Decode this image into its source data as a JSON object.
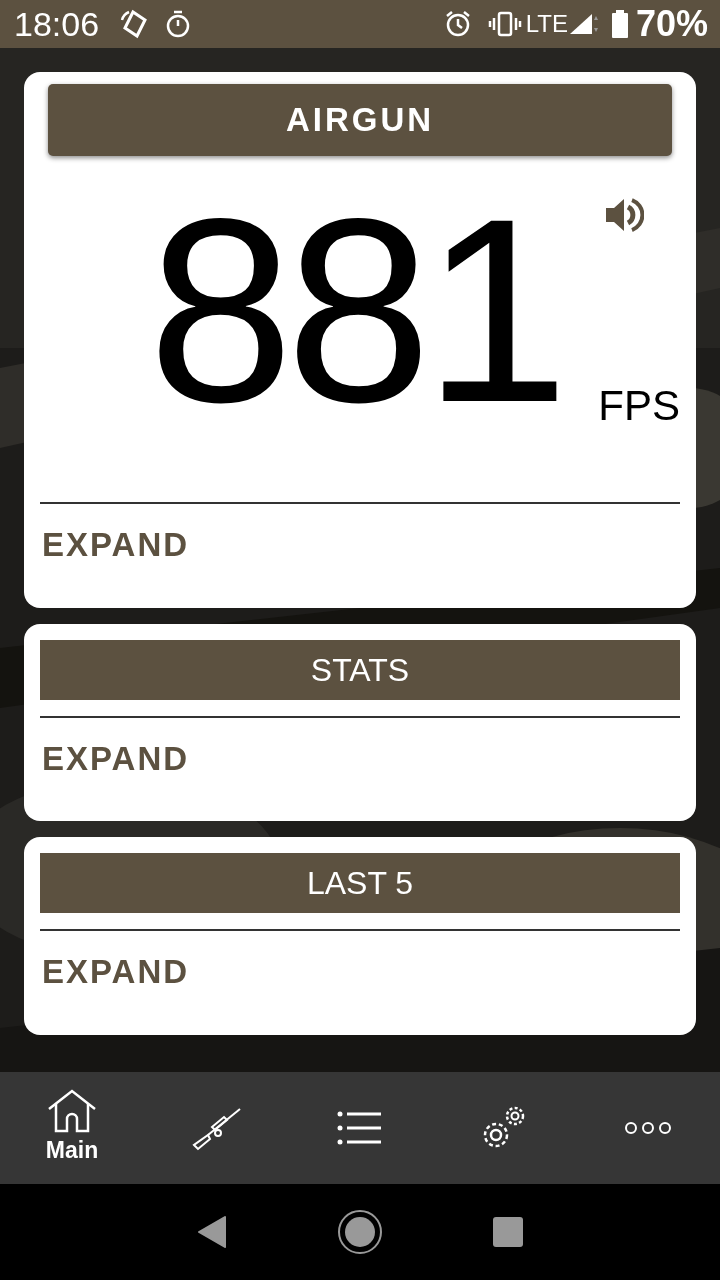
{
  "status_bar": {
    "time": "18:06",
    "network": "LTE",
    "battery": "70%"
  },
  "cards": [
    {
      "kind": "primary",
      "title": "AIRGUN",
      "reading": "881",
      "unit": "FPS",
      "expand": "EXPAND"
    },
    {
      "kind": "section",
      "title": "STATS",
      "expand": "EXPAND"
    },
    {
      "kind": "section",
      "title": "LAST 5",
      "expand": "EXPAND"
    }
  ],
  "bottom_nav": {
    "home_label": "Main"
  }
}
